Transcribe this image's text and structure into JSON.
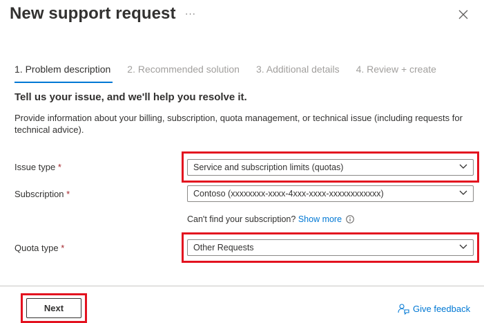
{
  "header": {
    "title": "New support request",
    "more_label": "···"
  },
  "tabs": [
    {
      "label": "1. Problem description",
      "active": true
    },
    {
      "label": "2. Recommended solution",
      "active": false
    },
    {
      "label": "3. Additional details",
      "active": false
    },
    {
      "label": "4. Review + create",
      "active": false
    }
  ],
  "main": {
    "heading": "Tell us your issue, and we'll help you resolve it.",
    "description": "Provide information about your billing, subscription, quota management, or technical issue (including requests for technical advice)."
  },
  "form": {
    "required_marker": "*",
    "issue_type": {
      "label": "Issue type",
      "value": "Service and subscription limits (quotas)"
    },
    "subscription": {
      "label": "Subscription",
      "value": "Contoso (xxxxxxxx-xxxx-4xxx-xxxx-xxxxxxxxxxxx)"
    },
    "find_subscription": {
      "text": "Can't find your subscription?",
      "link": "Show more"
    },
    "quota_type": {
      "label": "Quota type",
      "value": "Other Requests"
    }
  },
  "footer": {
    "next_label": "Next",
    "feedback_label": "Give feedback"
  },
  "colors": {
    "accent": "#0078d4",
    "highlight": "#e3121f",
    "required": "#a4262c"
  }
}
